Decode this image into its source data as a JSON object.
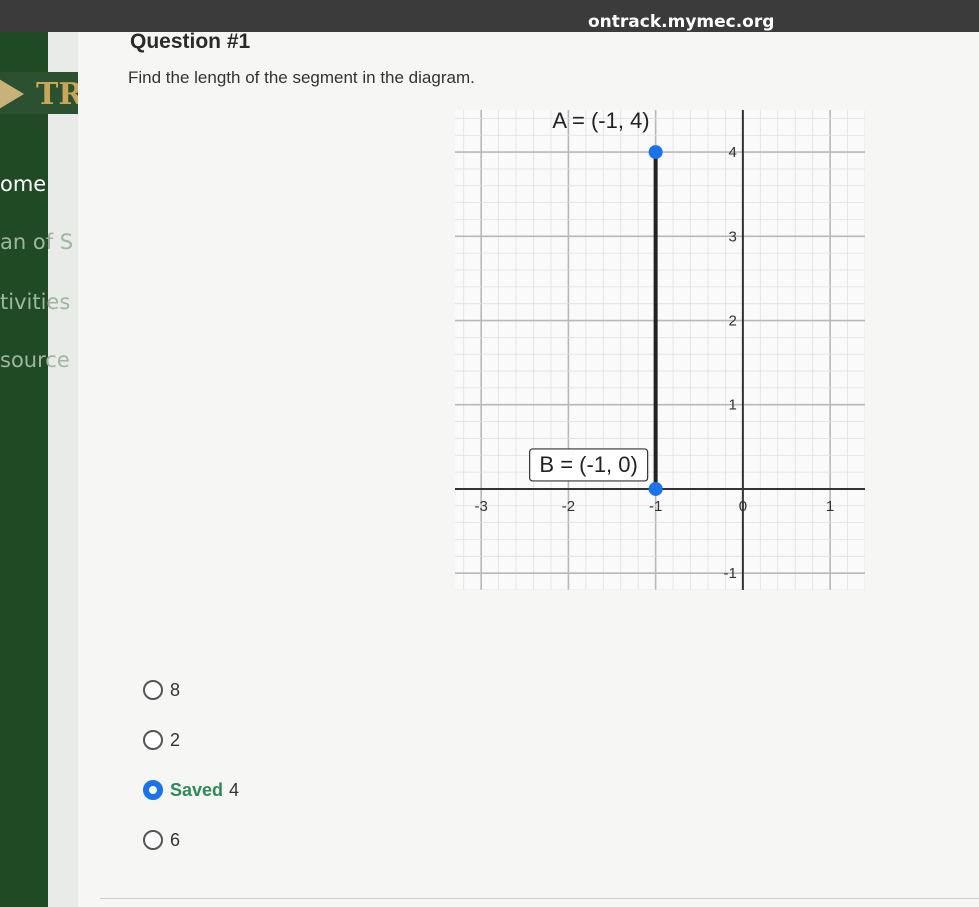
{
  "browser": {
    "url": "ontrack.mymec.org"
  },
  "sidebar": {
    "logo_text": "TR",
    "items": [
      {
        "label": "ome"
      },
      {
        "label": "an of S"
      },
      {
        "label": "tivities"
      },
      {
        "label": "source"
      }
    ]
  },
  "question": {
    "title": "Question #1",
    "prompt": "Find the length of the segment in the diagram."
  },
  "diagram": {
    "point_a_label": "A = (-1, 4)",
    "point_b_label": "B = (-1, 0)",
    "point_color": "#1a73e8",
    "x_ticks": [
      "-3",
      "-2",
      "-1",
      "0",
      "1"
    ],
    "y_ticks": [
      "4",
      "3",
      "2",
      "1",
      "-1"
    ]
  },
  "chart_data": {
    "type": "scatter",
    "title": "",
    "xlabel": "",
    "ylabel": "",
    "xlim": [
      -3.3,
      1.4
    ],
    "ylim": [
      -1.2,
      4.5
    ],
    "grid": true,
    "series": [
      {
        "x": [
          -1,
          -1
        ],
        "y": [
          4,
          0
        ]
      }
    ],
    "annotations": [
      "A = (-1, 4)",
      "B = (-1, 0)"
    ]
  },
  "options": [
    {
      "value": "8",
      "selected": false,
      "status": ""
    },
    {
      "value": "2",
      "selected": false,
      "status": ""
    },
    {
      "value": "4",
      "selected": true,
      "status": "Saved"
    },
    {
      "value": "6",
      "selected": false,
      "status": ""
    }
  ]
}
